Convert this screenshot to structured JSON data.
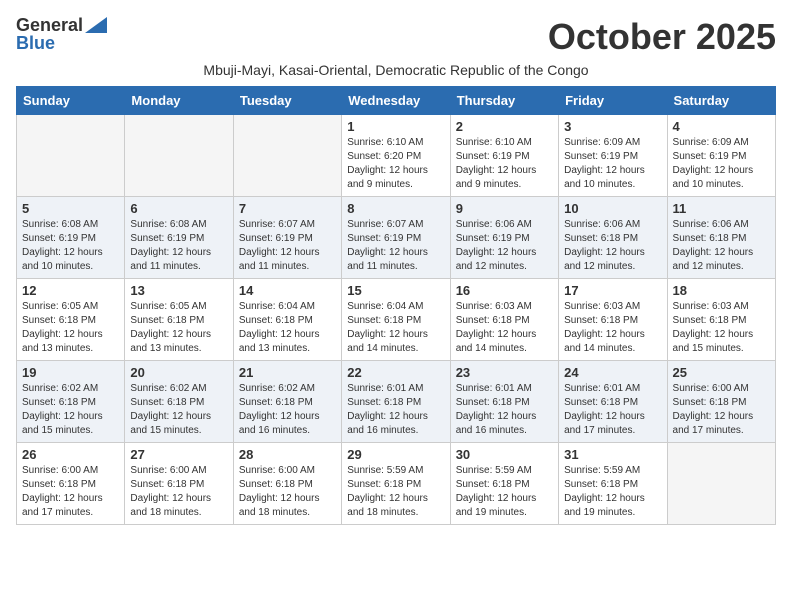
{
  "logo": {
    "general": "General",
    "blue": "Blue"
  },
  "title": "October 2025",
  "subtitle": "Mbuji-Mayi, Kasai-Oriental, Democratic Republic of the Congo",
  "headers": [
    "Sunday",
    "Monday",
    "Tuesday",
    "Wednesday",
    "Thursday",
    "Friday",
    "Saturday"
  ],
  "weeks": [
    {
      "shade": false,
      "days": [
        {
          "num": "",
          "info": ""
        },
        {
          "num": "",
          "info": ""
        },
        {
          "num": "",
          "info": ""
        },
        {
          "num": "1",
          "info": "Sunrise: 6:10 AM\nSunset: 6:20 PM\nDaylight: 12 hours\nand 9 minutes."
        },
        {
          "num": "2",
          "info": "Sunrise: 6:10 AM\nSunset: 6:19 PM\nDaylight: 12 hours\nand 9 minutes."
        },
        {
          "num": "3",
          "info": "Sunrise: 6:09 AM\nSunset: 6:19 PM\nDaylight: 12 hours\nand 10 minutes."
        },
        {
          "num": "4",
          "info": "Sunrise: 6:09 AM\nSunset: 6:19 PM\nDaylight: 12 hours\nand 10 minutes."
        }
      ]
    },
    {
      "shade": true,
      "days": [
        {
          "num": "5",
          "info": "Sunrise: 6:08 AM\nSunset: 6:19 PM\nDaylight: 12 hours\nand 10 minutes."
        },
        {
          "num": "6",
          "info": "Sunrise: 6:08 AM\nSunset: 6:19 PM\nDaylight: 12 hours\nand 11 minutes."
        },
        {
          "num": "7",
          "info": "Sunrise: 6:07 AM\nSunset: 6:19 PM\nDaylight: 12 hours\nand 11 minutes."
        },
        {
          "num": "8",
          "info": "Sunrise: 6:07 AM\nSunset: 6:19 PM\nDaylight: 12 hours\nand 11 minutes."
        },
        {
          "num": "9",
          "info": "Sunrise: 6:06 AM\nSunset: 6:19 PM\nDaylight: 12 hours\nand 12 minutes."
        },
        {
          "num": "10",
          "info": "Sunrise: 6:06 AM\nSunset: 6:18 PM\nDaylight: 12 hours\nand 12 minutes."
        },
        {
          "num": "11",
          "info": "Sunrise: 6:06 AM\nSunset: 6:18 PM\nDaylight: 12 hours\nand 12 minutes."
        }
      ]
    },
    {
      "shade": false,
      "days": [
        {
          "num": "12",
          "info": "Sunrise: 6:05 AM\nSunset: 6:18 PM\nDaylight: 12 hours\nand 13 minutes."
        },
        {
          "num": "13",
          "info": "Sunrise: 6:05 AM\nSunset: 6:18 PM\nDaylight: 12 hours\nand 13 minutes."
        },
        {
          "num": "14",
          "info": "Sunrise: 6:04 AM\nSunset: 6:18 PM\nDaylight: 12 hours\nand 13 minutes."
        },
        {
          "num": "15",
          "info": "Sunrise: 6:04 AM\nSunset: 6:18 PM\nDaylight: 12 hours\nand 14 minutes."
        },
        {
          "num": "16",
          "info": "Sunrise: 6:03 AM\nSunset: 6:18 PM\nDaylight: 12 hours\nand 14 minutes."
        },
        {
          "num": "17",
          "info": "Sunrise: 6:03 AM\nSunset: 6:18 PM\nDaylight: 12 hours\nand 14 minutes."
        },
        {
          "num": "18",
          "info": "Sunrise: 6:03 AM\nSunset: 6:18 PM\nDaylight: 12 hours\nand 15 minutes."
        }
      ]
    },
    {
      "shade": true,
      "days": [
        {
          "num": "19",
          "info": "Sunrise: 6:02 AM\nSunset: 6:18 PM\nDaylight: 12 hours\nand 15 minutes."
        },
        {
          "num": "20",
          "info": "Sunrise: 6:02 AM\nSunset: 6:18 PM\nDaylight: 12 hours\nand 15 minutes."
        },
        {
          "num": "21",
          "info": "Sunrise: 6:02 AM\nSunset: 6:18 PM\nDaylight: 12 hours\nand 16 minutes."
        },
        {
          "num": "22",
          "info": "Sunrise: 6:01 AM\nSunset: 6:18 PM\nDaylight: 12 hours\nand 16 minutes."
        },
        {
          "num": "23",
          "info": "Sunrise: 6:01 AM\nSunset: 6:18 PM\nDaylight: 12 hours\nand 16 minutes."
        },
        {
          "num": "24",
          "info": "Sunrise: 6:01 AM\nSunset: 6:18 PM\nDaylight: 12 hours\nand 17 minutes."
        },
        {
          "num": "25",
          "info": "Sunrise: 6:00 AM\nSunset: 6:18 PM\nDaylight: 12 hours\nand 17 minutes."
        }
      ]
    },
    {
      "shade": false,
      "days": [
        {
          "num": "26",
          "info": "Sunrise: 6:00 AM\nSunset: 6:18 PM\nDaylight: 12 hours\nand 17 minutes."
        },
        {
          "num": "27",
          "info": "Sunrise: 6:00 AM\nSunset: 6:18 PM\nDaylight: 12 hours\nand 18 minutes."
        },
        {
          "num": "28",
          "info": "Sunrise: 6:00 AM\nSunset: 6:18 PM\nDaylight: 12 hours\nand 18 minutes."
        },
        {
          "num": "29",
          "info": "Sunrise: 5:59 AM\nSunset: 6:18 PM\nDaylight: 12 hours\nand 18 minutes."
        },
        {
          "num": "30",
          "info": "Sunrise: 5:59 AM\nSunset: 6:18 PM\nDaylight: 12 hours\nand 19 minutes."
        },
        {
          "num": "31",
          "info": "Sunrise: 5:59 AM\nSunset: 6:18 PM\nDaylight: 12 hours\nand 19 minutes."
        },
        {
          "num": "",
          "info": ""
        }
      ]
    }
  ]
}
